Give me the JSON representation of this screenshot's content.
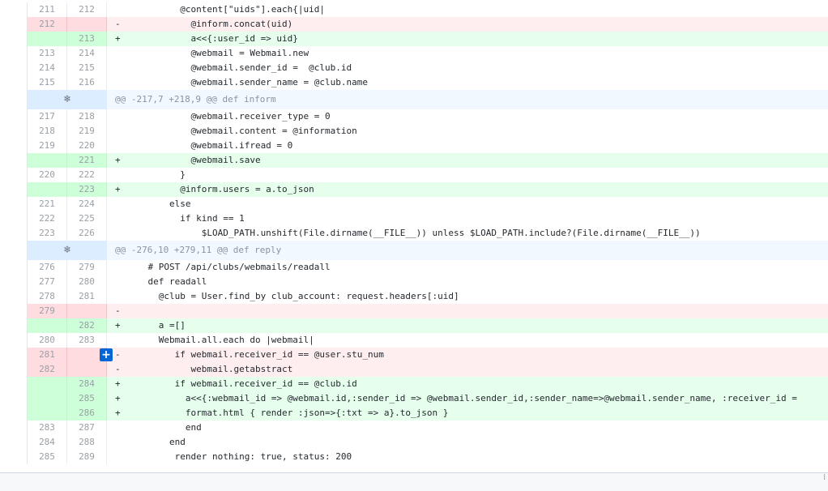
{
  "diff": {
    "lines": [
      {
        "type": "ctx",
        "old": "211",
        "new": "212",
        "sign": "",
        "code": "          @content[\"uids\"].each{|uid|"
      },
      {
        "type": "del",
        "old": "212",
        "new": "",
        "sign": "-",
        "code": "            @inform.concat(uid)"
      },
      {
        "type": "add",
        "old": "",
        "new": "213",
        "sign": "+",
        "code": "            a<<{:user_id => uid}"
      },
      {
        "type": "ctx",
        "old": "213",
        "new": "214",
        "sign": "",
        "code": "            @webmail = Webmail.new"
      },
      {
        "type": "ctx",
        "old": "214",
        "new": "215",
        "sign": "",
        "code": "            @webmail.sender_id =  @club.id"
      },
      {
        "type": "ctx",
        "old": "215",
        "new": "216",
        "sign": "",
        "code": "            @webmail.sender_name = @club.name"
      },
      {
        "type": "hunk",
        "text": "@@ -217,7 +218,9 @@ def inform"
      },
      {
        "type": "ctx",
        "old": "217",
        "new": "218",
        "sign": "",
        "code": "            @webmail.receiver_type = 0"
      },
      {
        "type": "ctx",
        "old": "218",
        "new": "219",
        "sign": "",
        "code": "            @webmail.content = @information"
      },
      {
        "type": "ctx",
        "old": "219",
        "new": "220",
        "sign": "",
        "code": "            @webmail.ifread = 0"
      },
      {
        "type": "add",
        "old": "",
        "new": "221",
        "sign": "+",
        "code": "            @webmail.save"
      },
      {
        "type": "ctx",
        "old": "220",
        "new": "222",
        "sign": "",
        "code": "          }"
      },
      {
        "type": "add",
        "old": "",
        "new": "223",
        "sign": "+",
        "code": "          @inform.users = a.to_json"
      },
      {
        "type": "ctx",
        "old": "221",
        "new": "224",
        "sign": "",
        "code": "        else"
      },
      {
        "type": "ctx",
        "old": "222",
        "new": "225",
        "sign": "",
        "code": "          if kind == 1"
      },
      {
        "type": "ctx",
        "old": "223",
        "new": "226",
        "sign": "",
        "code": "              $LOAD_PATH.unshift(File.dirname(__FILE__)) unless $LOAD_PATH.include?(File.dirname(__FILE__))"
      },
      {
        "type": "hunk",
        "text": "@@ -276,10 +279,11 @@ def reply"
      },
      {
        "type": "ctx",
        "old": "276",
        "new": "279",
        "sign": "",
        "code": "    # POST /api/clubs/webmails/readall"
      },
      {
        "type": "ctx",
        "old": "277",
        "new": "280",
        "sign": "",
        "code": "    def readall"
      },
      {
        "type": "ctx",
        "old": "278",
        "new": "281",
        "sign": "",
        "code": "      @club = User.find_by club_account: request.headers[:uid]"
      },
      {
        "type": "del",
        "old": "279",
        "new": "",
        "sign": "-",
        "code": ""
      },
      {
        "type": "add",
        "old": "",
        "new": "282",
        "sign": "+",
        "code": "      a =[]"
      },
      {
        "type": "ctx",
        "old": "280",
        "new": "283",
        "sign": "",
        "code": "      Webmail.all.each do |webmail|"
      },
      {
        "type": "del",
        "old": "281",
        "new": "",
        "sign": "-",
        "code": "         if webmail.receiver_id == @user.stu_num"
      },
      {
        "type": "del",
        "old": "282",
        "new": "",
        "sign": "-",
        "code": "            webmail.getabstract"
      },
      {
        "type": "add",
        "old": "",
        "new": "284",
        "sign": "+",
        "code": "         if webmail.receiver_id == @club.id"
      },
      {
        "type": "add",
        "old": "",
        "new": "285",
        "sign": "+",
        "code": "           a<<{:webmail_id => @webmail.id,:sender_id => @webmail.sender_id,:sender_name=>@webmail.sender_name, :receiver_id ="
      },
      {
        "type": "add",
        "old": "",
        "new": "286",
        "sign": "+",
        "code": "           format.html { render :json=>{:txt => a}.to_json }"
      },
      {
        "type": "ctx",
        "old": "283",
        "new": "287",
        "sign": "",
        "code": "           end"
      },
      {
        "type": "ctx",
        "old": "284",
        "new": "288",
        "sign": "",
        "code": "        end"
      },
      {
        "type": "ctx",
        "old": "285",
        "new": "289",
        "sign": "",
        "code": "         render nothing: true, status: 200"
      }
    ],
    "expand_icon": "unfold-icon",
    "comment_button_icon": "plus-icon",
    "comment_button_glyph": "+"
  },
  "colors": {
    "add_bg": "#e6ffed",
    "del_bg": "#ffeef0",
    "hunk_bg": "#f1f8ff",
    "add_highlight": "#acf2bd"
  }
}
